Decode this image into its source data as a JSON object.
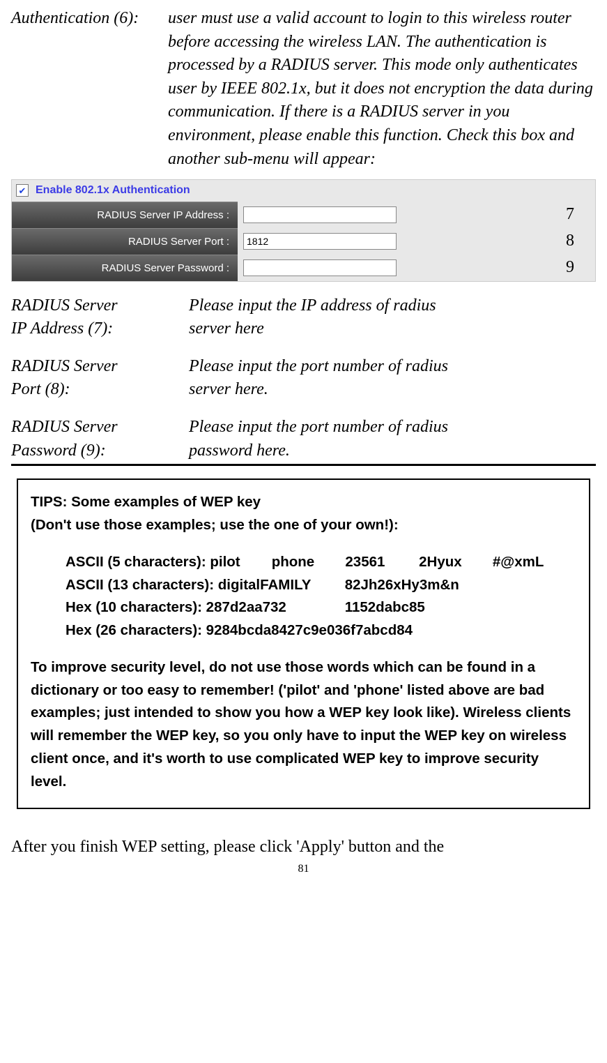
{
  "auth6": {
    "term": "Authentication (6):",
    "desc": "user must use a valid account to login to this wireless router before accessing the wireless LAN. The authentication is processed by a RADIUS server. This mode only authenticates user by IEEE 802.1x, but it does not encryption the data during communication. If there is a RADIUS server in you environment, please enable this function. Check this box and another sub-menu will appear:"
  },
  "panel": {
    "enable_label": "Enable 802.1x Authentication",
    "rows": [
      {
        "label": "RADIUS Server IP Address :",
        "value": "",
        "marker": "7"
      },
      {
        "label": "RADIUS Server Port :",
        "value": "1812",
        "marker": "8"
      },
      {
        "label": "RADIUS Server Password :",
        "value": "",
        "marker": "9"
      }
    ]
  },
  "radius": {
    "ip": {
      "term1": "RADIUS Server",
      "term2": "IP Address (7):",
      "desc1": "Please input the IP address of radius",
      "desc2": "server here"
    },
    "port": {
      "term1": "RADIUS Server",
      "term2": "Port (8):",
      "desc1": "Please input the port number of radius",
      "desc2": "server here."
    },
    "pwd": {
      "term1": "RADIUS Server",
      "term2": "Password (9):",
      "desc1": "Please input the port number of radius",
      "desc2": "password here."
    }
  },
  "tips": {
    "heading": "TIPS: Some examples of WEP key",
    "subheading": "(Don't use those examples; use the one of your own!):",
    "ex1_lbl": "ASCII (5 characters): pilot",
    "ex1_v1": "phone",
    "ex1_v2": "23561",
    "ex1_v3": "2Hyux",
    "ex1_v4": "#@xmL",
    "ex2_lbl": "ASCII (13 characters): digitalFAMILY",
    "ex2_v1": "82Jh26xHy3m&n",
    "ex3_lbl": "Hex (10 characters): 287d2aa732",
    "ex3_v1": "1152dabc85",
    "ex4_lbl": "Hex (26 characters): 9284bcda8427c9e036f7abcd84",
    "note": "To improve security level, do not use those words which can be found in a dictionary or too easy to remember! ('pilot' and 'phone' listed above are bad examples; just intended to show you how a WEP key look like). Wireless clients will remember the WEP key, so you only have to input the WEP key on wireless client once, and it's worth to use complicated WEP key to improve security level."
  },
  "after_text": "After you finish WEP setting, please click 'Apply' button and the",
  "page_number": "81"
}
